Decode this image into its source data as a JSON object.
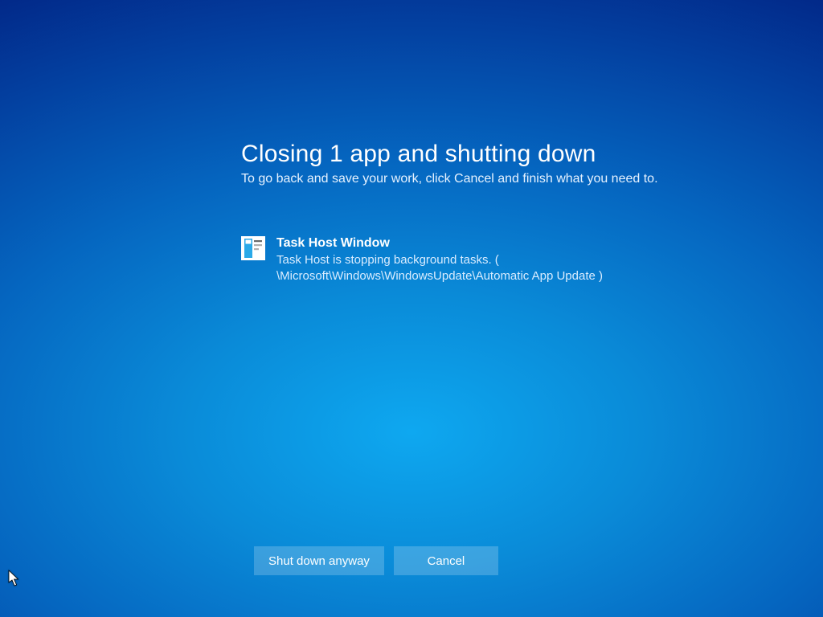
{
  "header": {
    "title": "Closing 1 app and shutting down",
    "subtitle": "To go back and save your work, click Cancel and finish what you need to."
  },
  "apps": [
    {
      "name": "Task Host Window",
      "description": "Task Host is stopping background tasks. ( \\Microsoft\\Windows\\WindowsUpdate\\Automatic App Update )",
      "icon": "task-host-icon"
    }
  ],
  "buttons": {
    "shutdown": "Shut down anyway",
    "cancel": "Cancel"
  }
}
